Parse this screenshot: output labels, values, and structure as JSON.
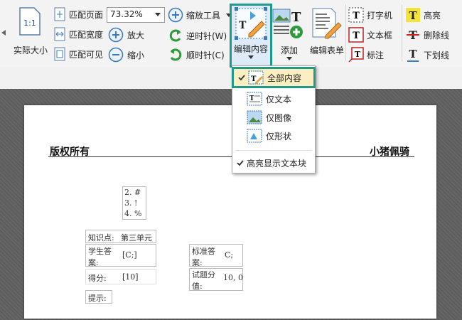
{
  "ribbon": {
    "actual_size_label": "实际大小",
    "fit_page_label": "匹配页面",
    "fit_width_label": "匹配宽度",
    "fit_visible_label": "匹配可见",
    "zoom_value": "73.32%",
    "zoom_tool_label": "缩放工具",
    "zoom_in_label": "放大",
    "zoom_out_label": "缩小",
    "rotate_ccw_label": "逆时针(W)",
    "rotate_cw_label": "顺时针(C)",
    "edit_content_label": "编辑内容",
    "add_label": "添加",
    "edit_form_label": "编辑表单",
    "typewriter_label": "打字机",
    "textbox_label": "文本框",
    "callout_label": "标注",
    "highlight_label": "高亮",
    "strikeout_label": "删除线",
    "underline_label": "下划线",
    "actual_size_icon_text": "1:1",
    "accent": "#1f9a8a"
  },
  "menu": {
    "items": [
      {
        "label": "全部内容",
        "checked": true,
        "selected": true
      },
      {
        "label": "仅文本"
      },
      {
        "label": "仅图像"
      },
      {
        "label": "仅形状"
      },
      {
        "label": "高亮显示文本块",
        "checked": true
      }
    ]
  },
  "document": {
    "header_left": "版权所有",
    "header_right": "小猪佩骑",
    "list": [
      "2.  #",
      "3.  !",
      "4.  %"
    ],
    "knowledge_label": "知识点:",
    "knowledge_value": "第三单元",
    "student_answer_label": "学生答案:",
    "student_answer_value": "[C;]",
    "standard_answer_label": "标准答案:",
    "standard_answer_value": "C;",
    "score_label": "得分:",
    "score_value": "[10]",
    "question_score_label": "试题分值:",
    "question_score_value": "10, 0",
    "hint_label": "提示:"
  }
}
